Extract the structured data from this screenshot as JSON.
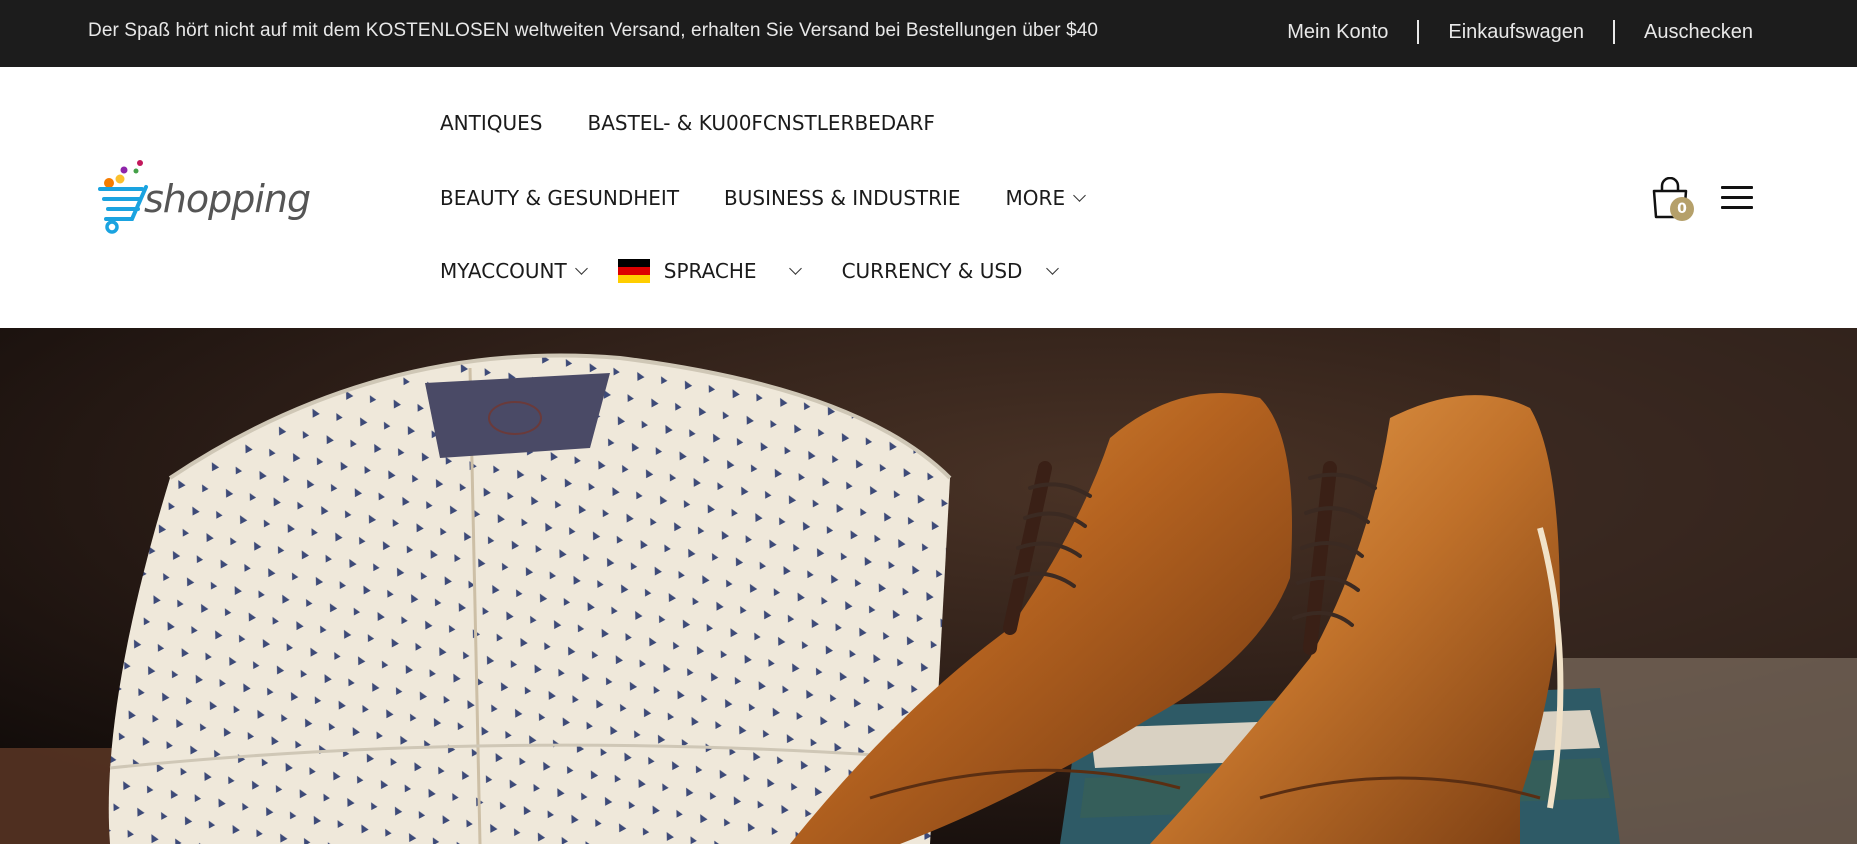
{
  "topbar": {
    "promo": "Der Spaß hört nicht auf mit dem KOSTENLOSEN weltweiten Versand, erhalten Sie Versand bei Bestellungen über $40",
    "links": [
      "Mein Konto",
      "Einkaufswagen",
      "Auschecken"
    ]
  },
  "header": {
    "logo_text": "shopping",
    "nav": {
      "row1": [
        "ANTIQUES",
        "BASTEL- & KU00FCNSTLERBEDARF"
      ],
      "row2": [
        "BEAUTY & GESUNDHEIT",
        "BUSINESS & INDUSTRIE",
        "MORE"
      ],
      "row3": {
        "account": "MYACCOUNT",
        "language": "SPRACHE",
        "currency": "CURRENCY & USD"
      }
    },
    "cart_count": "0"
  },
  "colors": {
    "topbar_bg": "#1c1c1c",
    "cart_badge": "#b5a06a",
    "logo_blue": "#1aa3e0"
  },
  "icons": {
    "cart": "shopping-bag-icon",
    "menu": "hamburger-menu-icon",
    "language_flag": "german-flag-icon"
  }
}
